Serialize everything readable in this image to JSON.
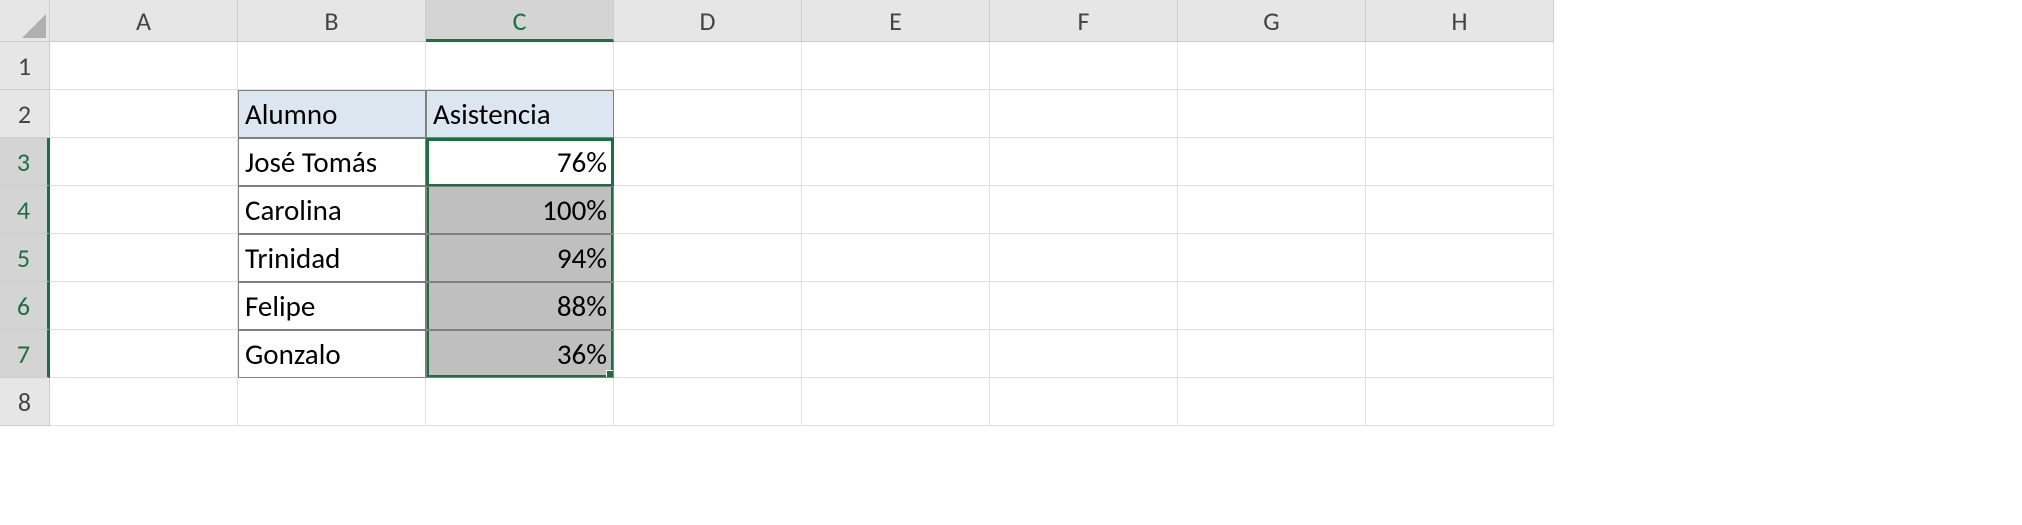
{
  "columns": [
    "A",
    "B",
    "C",
    "D",
    "E",
    "F",
    "G",
    "H"
  ],
  "rows": [
    "1",
    "2",
    "3",
    "4",
    "5",
    "6",
    "7",
    "8"
  ],
  "active_cell": "C3",
  "selection_range": "C3:C7",
  "table": {
    "headers": {
      "alumno": "Alumno",
      "asistencia": "Asistencia"
    },
    "rows": [
      {
        "alumno": "José Tomás",
        "asistencia": "76%"
      },
      {
        "alumno": "Carolina",
        "asistencia": "100%"
      },
      {
        "alumno": "Trinidad",
        "asistencia": "94%"
      },
      {
        "alumno": "Felipe",
        "asistencia": "88%"
      },
      {
        "alumno": "Gonzalo",
        "asistencia": "36%"
      }
    ]
  }
}
